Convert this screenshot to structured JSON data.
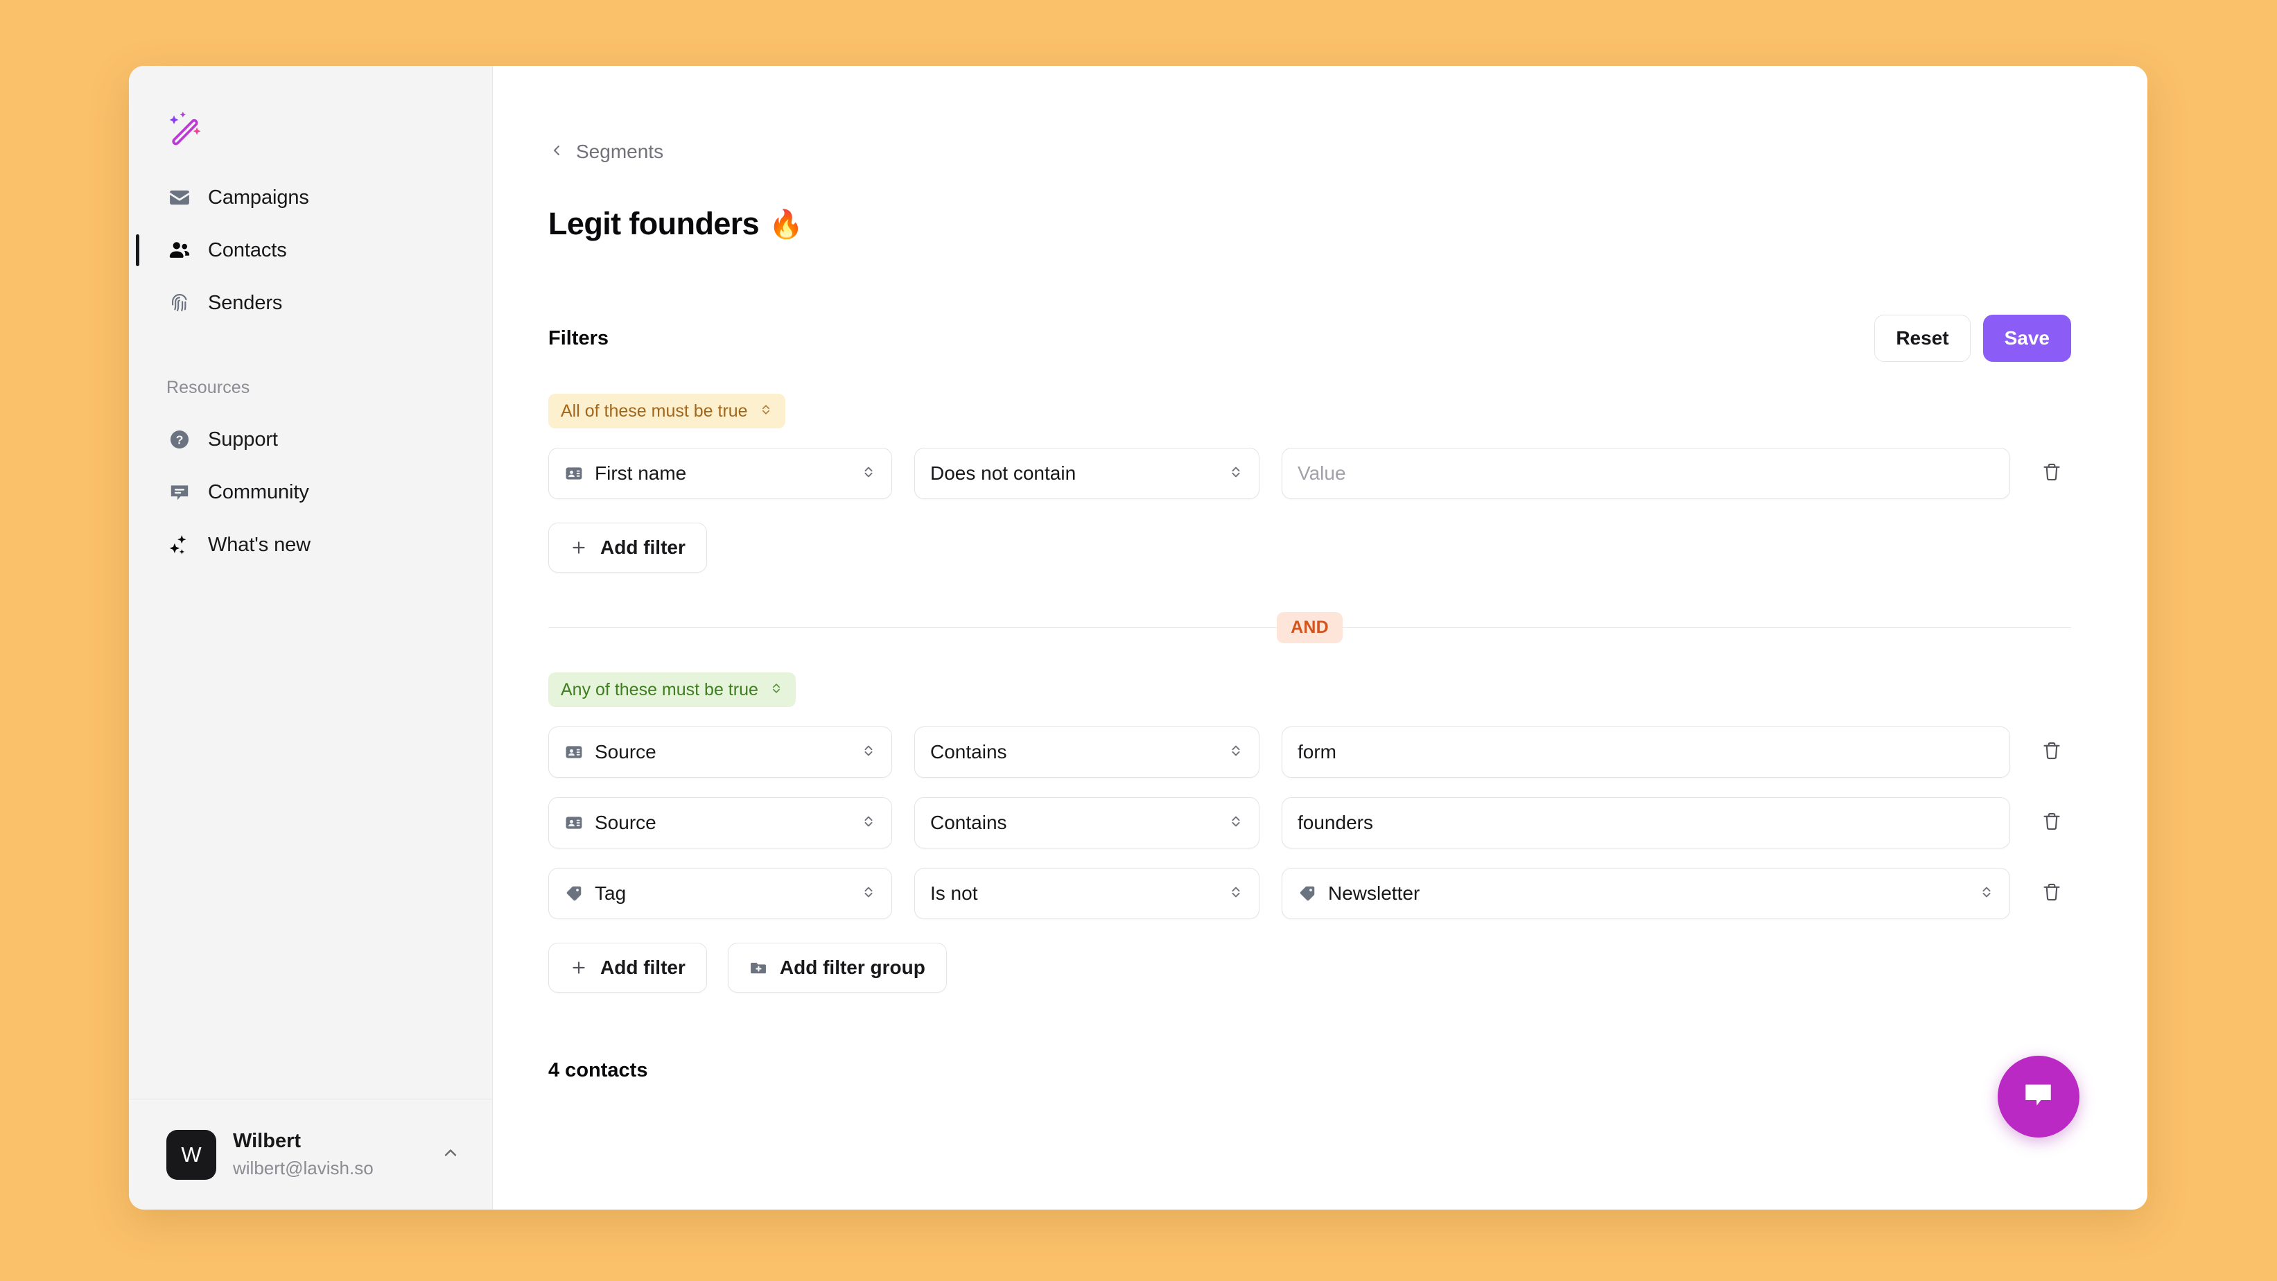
{
  "brand": {
    "logo_icon": "magic-wand-icon"
  },
  "sidebar": {
    "nav": [
      {
        "label": "Campaigns",
        "icon": "envelope-icon",
        "active": false
      },
      {
        "label": "Contacts",
        "icon": "people-icon",
        "active": true
      },
      {
        "label": "Senders",
        "icon": "fingerprint-icon",
        "active": false
      }
    ],
    "resources_label": "Resources",
    "resources": [
      {
        "label": "Support",
        "icon": "question-circle-icon"
      },
      {
        "label": "Community",
        "icon": "chat-bubble-icon"
      },
      {
        "label": "What's new",
        "icon": "sparkles-icon"
      }
    ],
    "user": {
      "initial": "W",
      "name": "Wilbert",
      "email": "wilbert@lavish.so",
      "chevron_icon": "chevron-up-icon"
    }
  },
  "main": {
    "breadcrumb": {
      "back_icon": "chevron-left-icon",
      "label": "Segments"
    },
    "title": "Legit founders",
    "title_emoji": "🔥",
    "filters_label": "Filters",
    "reset_label": "Reset",
    "save_label": "Save",
    "add_filter_label": "Add filter",
    "add_filter_group_label": "Add filter group",
    "value_placeholder": "Value",
    "contacts_count": "4 contacts",
    "group_join_operator": "AND",
    "groups": [
      {
        "match_label": "All of these must be true",
        "match_type": "all",
        "rows": [
          {
            "field": "First name",
            "field_icon": "contact-card-icon",
            "operator": "Does not contain",
            "value": "",
            "value_kind": "input",
            "value_icon": "",
            "delete_icon": "trash-icon"
          }
        ]
      },
      {
        "match_label": "Any of these must be true",
        "match_type": "any",
        "rows": [
          {
            "field": "Source",
            "field_icon": "contact-card-icon",
            "operator": "Contains",
            "value": "form",
            "value_kind": "input",
            "value_icon": "",
            "delete_icon": "trash-icon"
          },
          {
            "field": "Source",
            "field_icon": "contact-card-icon",
            "operator": "Contains",
            "value": "founders",
            "value_kind": "input",
            "value_icon": "",
            "delete_icon": "trash-icon"
          },
          {
            "field": "Tag",
            "field_icon": "tag-icon",
            "operator": "Is not",
            "value": "Newsletter",
            "value_kind": "select",
            "value_icon": "tag-icon",
            "delete_icon": "trash-icon"
          }
        ]
      }
    ]
  },
  "chat_widget": {
    "icon": "chat-bubble-icon"
  },
  "colors": {
    "page_background": "#fbc06a",
    "accent": "#8b5cf6",
    "badge_all_bg": "#fcf0cf",
    "badge_all_text": "#a1661b",
    "badge_any_bg": "#e6f4dc",
    "badge_any_text": "#3f7d20",
    "badge_and_bg": "#fde6d9",
    "badge_and_text": "#d2551f",
    "chat_widget": "#bb29c4"
  }
}
